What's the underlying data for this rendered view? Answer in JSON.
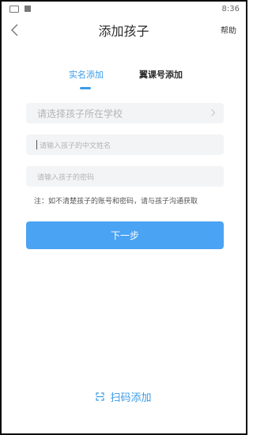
{
  "status_bar": {
    "time": "8:36",
    "icons": [
      "notification-icon",
      "app-icon"
    ]
  },
  "header": {
    "back_icon": "chevron-left-icon",
    "title": "添加孩子",
    "help_label": "帮助"
  },
  "tabs": [
    {
      "label": "实名添加",
      "active": true
    },
    {
      "label": "翼课号添加",
      "active": false
    }
  ],
  "form": {
    "school_placeholder": "请选择孩子所在学校",
    "name_placeholder": "请输入孩子的中文姓名",
    "password_placeholder": "请输入孩子的密码",
    "note": "注：如不清楚孩子的账号和密码，请与孩子沟通获取",
    "next_label": "下一步"
  },
  "scan": {
    "icon": "scan-icon",
    "label": "扫码添加"
  },
  "colors": {
    "accent": "#3a9be8",
    "button": "#4aa3f3",
    "field_bg": "#f3f4f6"
  }
}
